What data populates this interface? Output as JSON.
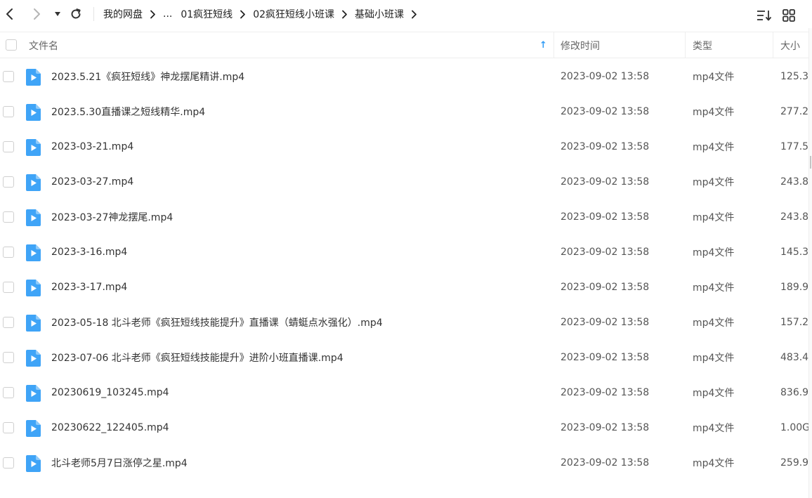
{
  "toolbar": {
    "back_icon": "chevron-left-icon",
    "forward_icon": "chevron-right-icon",
    "dropdown_icon": "caret-down-icon",
    "refresh_icon": "refresh-icon",
    "sort_icon": "sort-list-icon",
    "grid_icon": "grid-view-icon"
  },
  "breadcrumb": [
    "我的网盘",
    "...",
    "01疯狂短线",
    "02疯狂短线小班课",
    "基础小班课"
  ],
  "columns": {
    "name": "文件名",
    "modified": "修改时间",
    "type": "类型",
    "size": "大小",
    "sort_indicator": "↑"
  },
  "colors": {
    "accent": "#2f9bf5",
    "file_icon": "#3fa4f7"
  },
  "files": [
    {
      "name": "2023.5.21《疯狂短线》神龙摆尾精讲.mp4",
      "modified": "2023-09-02 13:58",
      "type": "mp4文件",
      "size": "125.3"
    },
    {
      "name": "2023.5.30直播课之短线精华.mp4",
      "modified": "2023-09-02 13:58",
      "type": "mp4文件",
      "size": "277.2"
    },
    {
      "name": "2023-03-21.mp4",
      "modified": "2023-09-02 13:58",
      "type": "mp4文件",
      "size": "177.5"
    },
    {
      "name": "2023-03-27.mp4",
      "modified": "2023-09-02 13:58",
      "type": "mp4文件",
      "size": "243.8"
    },
    {
      "name": "2023-03-27神龙摆尾.mp4",
      "modified": "2023-09-02 13:58",
      "type": "mp4文件",
      "size": "243.8"
    },
    {
      "name": "2023-3-16.mp4",
      "modified": "2023-09-02 13:58",
      "type": "mp4文件",
      "size": "145.3"
    },
    {
      "name": "2023-3-17.mp4",
      "modified": "2023-09-02 13:58",
      "type": "mp4文件",
      "size": "189.9"
    },
    {
      "name": "2023-05-18 北斗老师《疯狂短线技能提升》直播课（蜻蜓点水强化）.mp4",
      "modified": "2023-09-02 13:58",
      "type": "mp4文件",
      "size": "157.2"
    },
    {
      "name": "2023-07-06 北斗老师《疯狂短线技能提升》进阶小班直播课.mp4",
      "modified": "2023-09-02 13:58",
      "type": "mp4文件",
      "size": "483.4"
    },
    {
      "name": "20230619_103245.mp4",
      "modified": "2023-09-02 13:58",
      "type": "mp4文件",
      "size": "836.9"
    },
    {
      "name": "20230622_122405.mp4",
      "modified": "2023-09-02 13:58",
      "type": "mp4文件",
      "size": "1.00G"
    },
    {
      "name": "北斗老师5月7日涨停之星.mp4",
      "modified": "2023-09-02 13:58",
      "type": "mp4文件",
      "size": "259.9"
    }
  ]
}
